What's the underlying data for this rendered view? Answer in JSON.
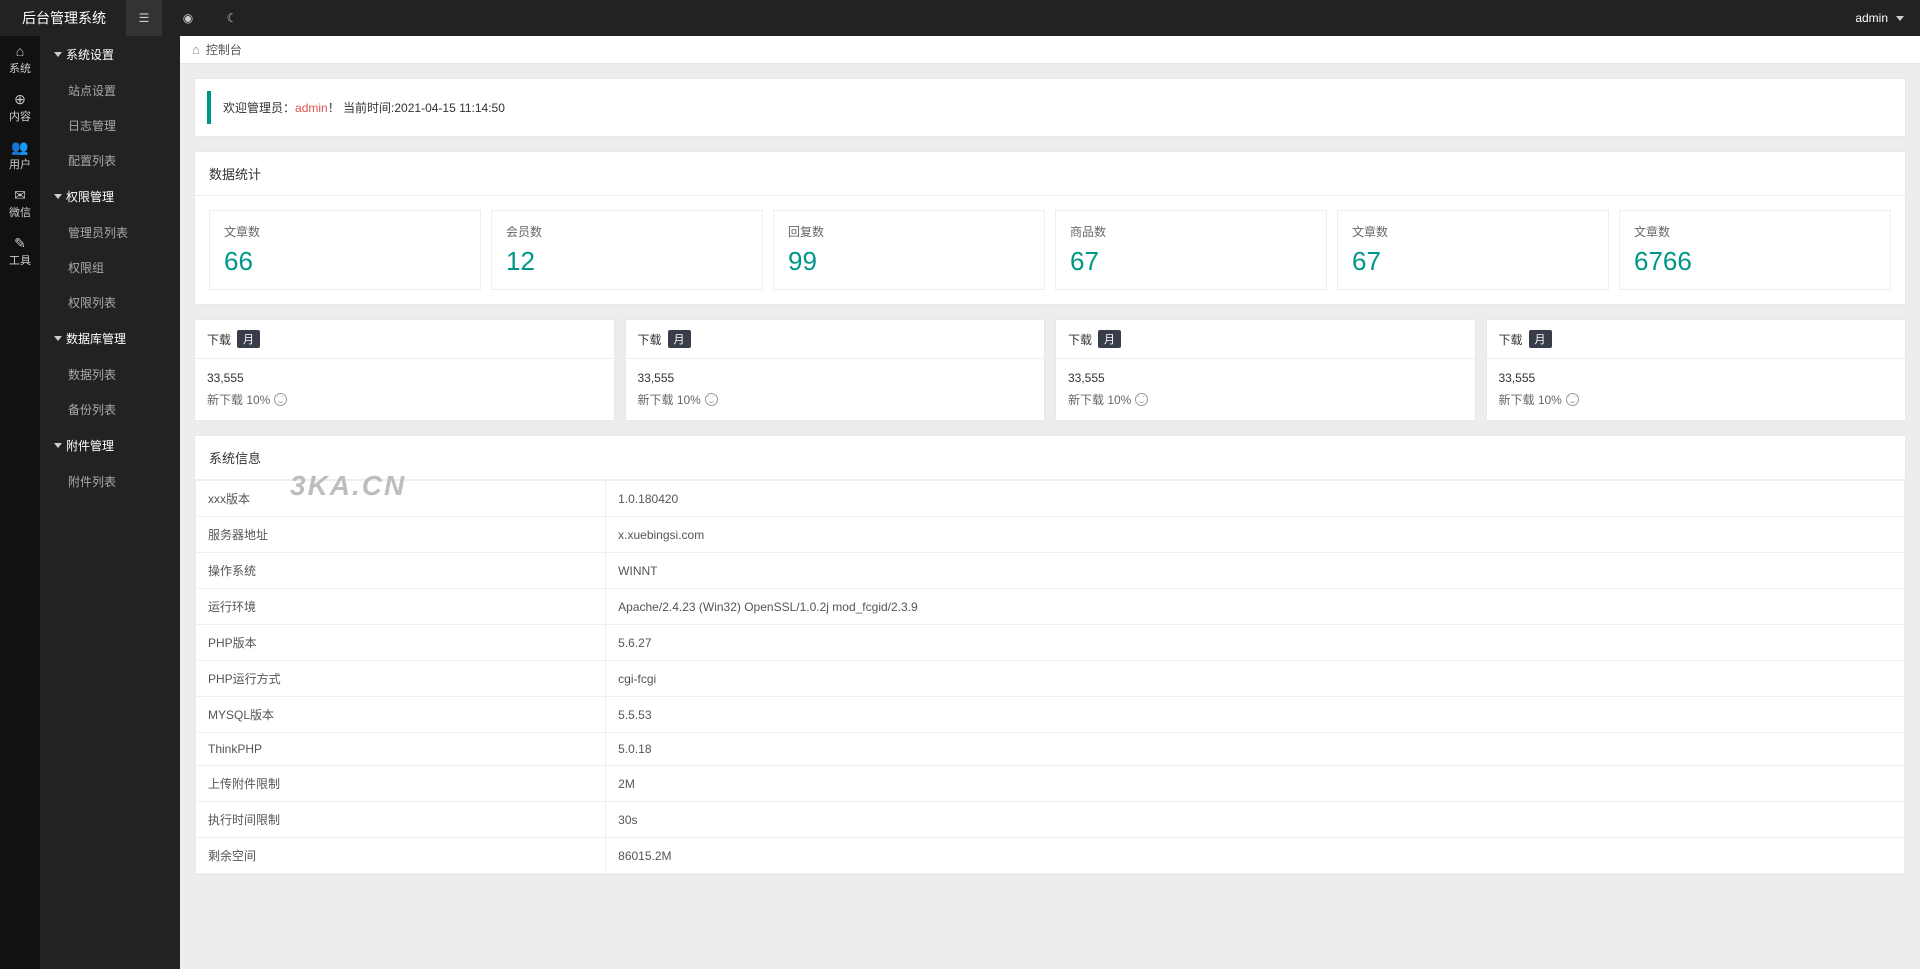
{
  "brand": "后台管理系统",
  "user": "admin",
  "rail": [
    {
      "icon": "⌂",
      "label": "系统"
    },
    {
      "icon": "⊕",
      "label": "内容"
    },
    {
      "icon": "👥",
      "label": "用户"
    },
    {
      "icon": "✉",
      "label": "微信"
    },
    {
      "icon": "✎",
      "label": "工具"
    }
  ],
  "menu": [
    {
      "title": "系统设置",
      "items": [
        "站点设置",
        "日志管理",
        "配置列表"
      ]
    },
    {
      "title": "权限管理",
      "items": [
        "管理员列表",
        "权限组",
        "权限列表"
      ]
    },
    {
      "title": "数据库管理",
      "items": [
        "数据列表",
        "备份列表"
      ]
    },
    {
      "title": "附件管理",
      "items": [
        "附件列表"
      ]
    }
  ],
  "breadcrumb": "控制台",
  "welcome": {
    "prefix": "欢迎管理员：",
    "name": "admin",
    "suffix": "！ 当前时间:2021-04-15 11:14:50"
  },
  "stats_title": "数据统计",
  "stats": [
    {
      "label": "文章数",
      "value": "66"
    },
    {
      "label": "会员数",
      "value": "12"
    },
    {
      "label": "回复数",
      "value": "99"
    },
    {
      "label": "商品数",
      "value": "67"
    },
    {
      "label": "文章数",
      "value": "67"
    },
    {
      "label": "文章数",
      "value": "6766"
    }
  ],
  "downloads": [
    {
      "title": "下载",
      "badge": "月",
      "count": "33,555",
      "sub": "新下载 10%"
    },
    {
      "title": "下载",
      "badge": "月",
      "count": "33,555",
      "sub": "新下载 10%"
    },
    {
      "title": "下载",
      "badge": "月",
      "count": "33,555",
      "sub": "新下载 10%"
    },
    {
      "title": "下载",
      "badge": "月",
      "count": "33,555",
      "sub": "新下载 10%"
    }
  ],
  "sysinfo_title": "系统信息",
  "sysinfo": [
    {
      "k": "xxx版本",
      "v": "1.0.180420"
    },
    {
      "k": "服务器地址",
      "v": "x.xuebingsi.com"
    },
    {
      "k": "操作系统",
      "v": "WINNT"
    },
    {
      "k": "运行环境",
      "v": "Apache/2.4.23 (Win32) OpenSSL/1.0.2j mod_fcgid/2.3.9"
    },
    {
      "k": "PHP版本",
      "v": "5.6.27"
    },
    {
      "k": "PHP运行方式",
      "v": "cgi-fcgi"
    },
    {
      "k": "MYSQL版本",
      "v": "5.5.53"
    },
    {
      "k": "ThinkPHP",
      "v": "5.0.18"
    },
    {
      "k": "上传附件限制",
      "v": "2M"
    },
    {
      "k": "执行时间限制",
      "v": "30s"
    },
    {
      "k": "剩余空间",
      "v": "86015.2M"
    }
  ],
  "watermark": "3KA.CN"
}
